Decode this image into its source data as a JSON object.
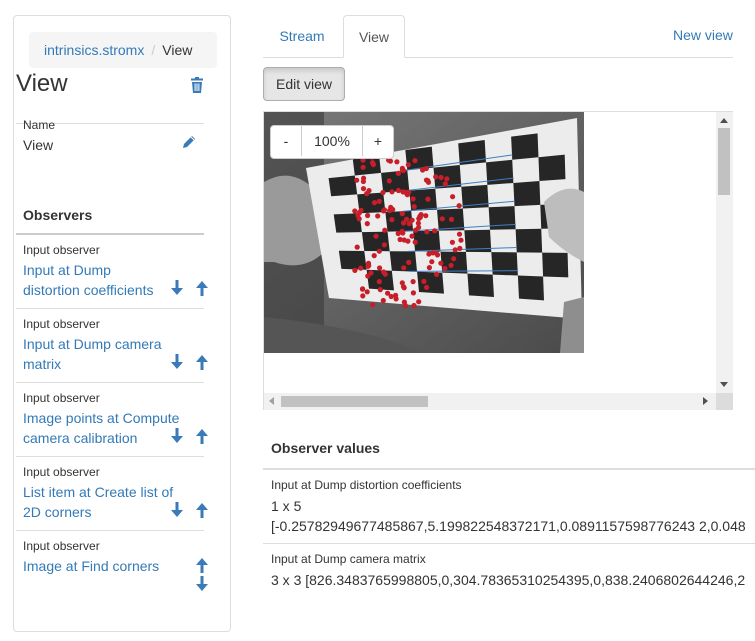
{
  "breadcrumb": {
    "root": "intrinsics.stromx",
    "current": "View"
  },
  "view": {
    "title": "View",
    "name_label": "Name",
    "name_value": "View"
  },
  "observers_heading": "Observers",
  "observers": [
    {
      "type": "Input observer",
      "label": "Input at Dump distortion coefficients"
    },
    {
      "type": "Input observer",
      "label": "Input at Dump camera matrix"
    },
    {
      "type": "Input observer",
      "label": "Image points at Compute camera calibration"
    },
    {
      "type": "Input observer",
      "label": "List item at Create list of 2D corners"
    },
    {
      "type": "Input observer",
      "label": "Image at Find corners"
    }
  ],
  "tabs": [
    {
      "label": "Stream"
    },
    {
      "label": "View"
    }
  ],
  "new_view": "New view",
  "edit_view": "Edit view",
  "zoom": {
    "minus": "-",
    "value": "100%",
    "plus": "+"
  },
  "observer_values": {
    "heading": "Observer values",
    "items": [
      {
        "label": "Input at Dump distortion coefficients",
        "line1": "1 x 5",
        "line2": "[-0.25782949677485867,5.199822548372171,0.0891157598776243 2,0.048"
      },
      {
        "label": "Input at Dump camera matrix",
        "line1": "3 x 3 [826.3483765998805,0,304.78365310254395,0,838.2406802644246,2"
      }
    ]
  },
  "colors": {
    "link": "#337ab7",
    "icon": "#3a7ab8",
    "border": "#dddddd",
    "point": "#c81e2a",
    "line": "#3d7fc4"
  },
  "icons": {
    "delete": "trash-icon",
    "edit": "pencil-icon",
    "down": "arrow-down-icon",
    "up": "arrow-up-icon"
  }
}
